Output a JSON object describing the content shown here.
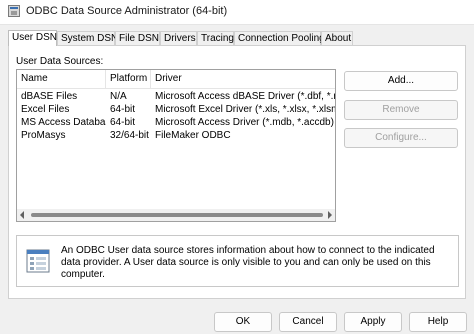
{
  "window": {
    "title": "ODBC Data Source Administrator (64-bit)"
  },
  "tabs": [
    {
      "label": "User DSN",
      "active": true
    },
    {
      "label": "System DSN"
    },
    {
      "label": "File DSN"
    },
    {
      "label": "Drivers"
    },
    {
      "label": "Tracing"
    },
    {
      "label": "Connection Pooling"
    },
    {
      "label": "About"
    }
  ],
  "user_dsn": {
    "section_label": "User Data Sources:",
    "columns": [
      "Name",
      "Platform",
      "Driver"
    ],
    "rows": [
      {
        "name": "dBASE Files",
        "platform": "N/A",
        "driver": "Microsoft Access dBASE Driver (*.dbf, *.ndx, *.mdx)"
      },
      {
        "name": "Excel Files",
        "platform": "64-bit",
        "driver": "Microsoft Excel Driver (*.xls, *.xlsx, *.xlsm, *.xlsb)"
      },
      {
        "name": "MS Access Database",
        "platform": "64-bit",
        "driver": "Microsoft Access Driver (*.mdb, *.accdb)"
      },
      {
        "name": "ProMasys",
        "platform": "32/64-bit",
        "driver": "FileMaker ODBC"
      }
    ],
    "buttons": {
      "add": "Add...",
      "remove": "Remove",
      "configure": "Configure..."
    },
    "info_text": "An ODBC User data source stores information about how to connect to the indicated data provider.  A User data source is only visible to you and can only be used on this computer."
  },
  "footer": {
    "ok": "OK",
    "cancel": "Cancel",
    "apply": "Apply",
    "help": "Help"
  }
}
